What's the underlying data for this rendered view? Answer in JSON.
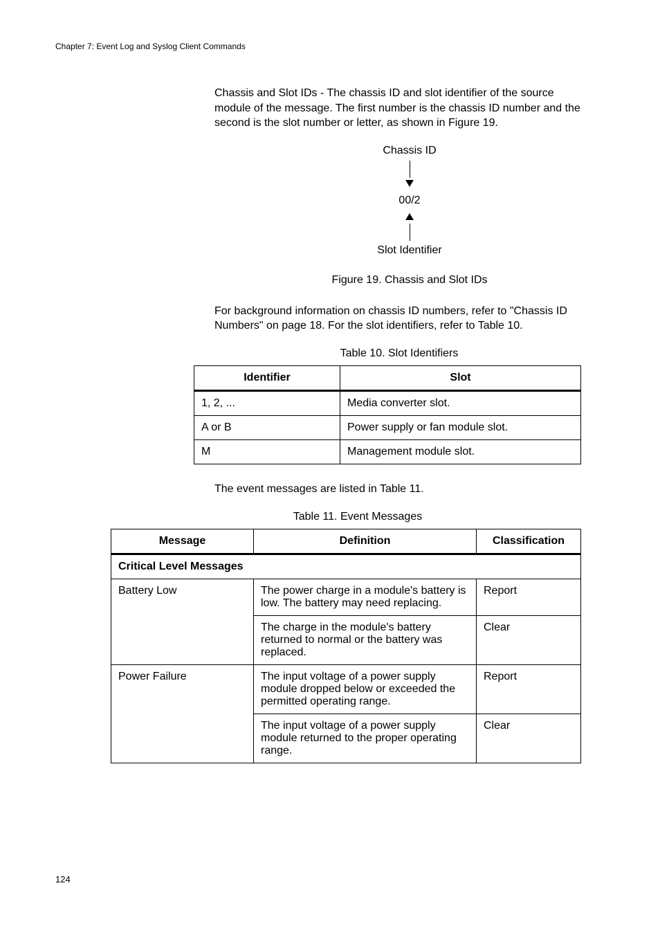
{
  "header": {
    "chapter": "Chapter 7: Event Log and Syslog Client Commands"
  },
  "para1": "Chassis and Slot IDs - The chassis ID and slot identifier of the source module of the message. The first number is the chassis ID number and the second is the slot number or letter, as shown in Figure 19.",
  "figure": {
    "top_label": "Chassis ID",
    "middle": "00/2",
    "bottom_label": "Slot Identifier",
    "caption": "Figure 19. Chassis and Slot IDs"
  },
  "para2": "For background information on chassis ID numbers, refer to \"Chassis ID Numbers\" on page 18. For the slot identifiers, refer to Table 10.",
  "table10": {
    "caption": "Table 10. Slot Identifiers",
    "headers": {
      "col1": "Identifier",
      "col2": "Slot"
    },
    "rows": [
      {
        "c1": "1, 2, ...",
        "c2": "Media converter slot."
      },
      {
        "c1": "A or B",
        "c2": "Power supply or fan module slot."
      },
      {
        "c1": "M",
        "c2": "Management module slot."
      }
    ]
  },
  "para3": "The event messages are listed in Table 11.",
  "table11": {
    "caption": "Table 11. Event Messages",
    "headers": {
      "c1": "Message",
      "c2": "Definition",
      "c3": "Classification"
    },
    "section": "Critical Level Messages",
    "rows": [
      {
        "msg": "Battery Low",
        "def": "The power charge in a module's battery is low. The battery may need replacing.",
        "cls": "Report"
      },
      {
        "msg": "",
        "def": "The charge in the module's battery returned to normal or the battery was replaced.",
        "cls": "Clear"
      },
      {
        "msg": "Power Failure",
        "def": "The input voltage of a power supply module dropped below or exceeded the permitted operating range.",
        "cls": "Report"
      },
      {
        "msg": "",
        "def": "The input voltage of a power supply module returned to the proper operating range.",
        "cls": "Clear"
      }
    ]
  },
  "page_number": "124"
}
